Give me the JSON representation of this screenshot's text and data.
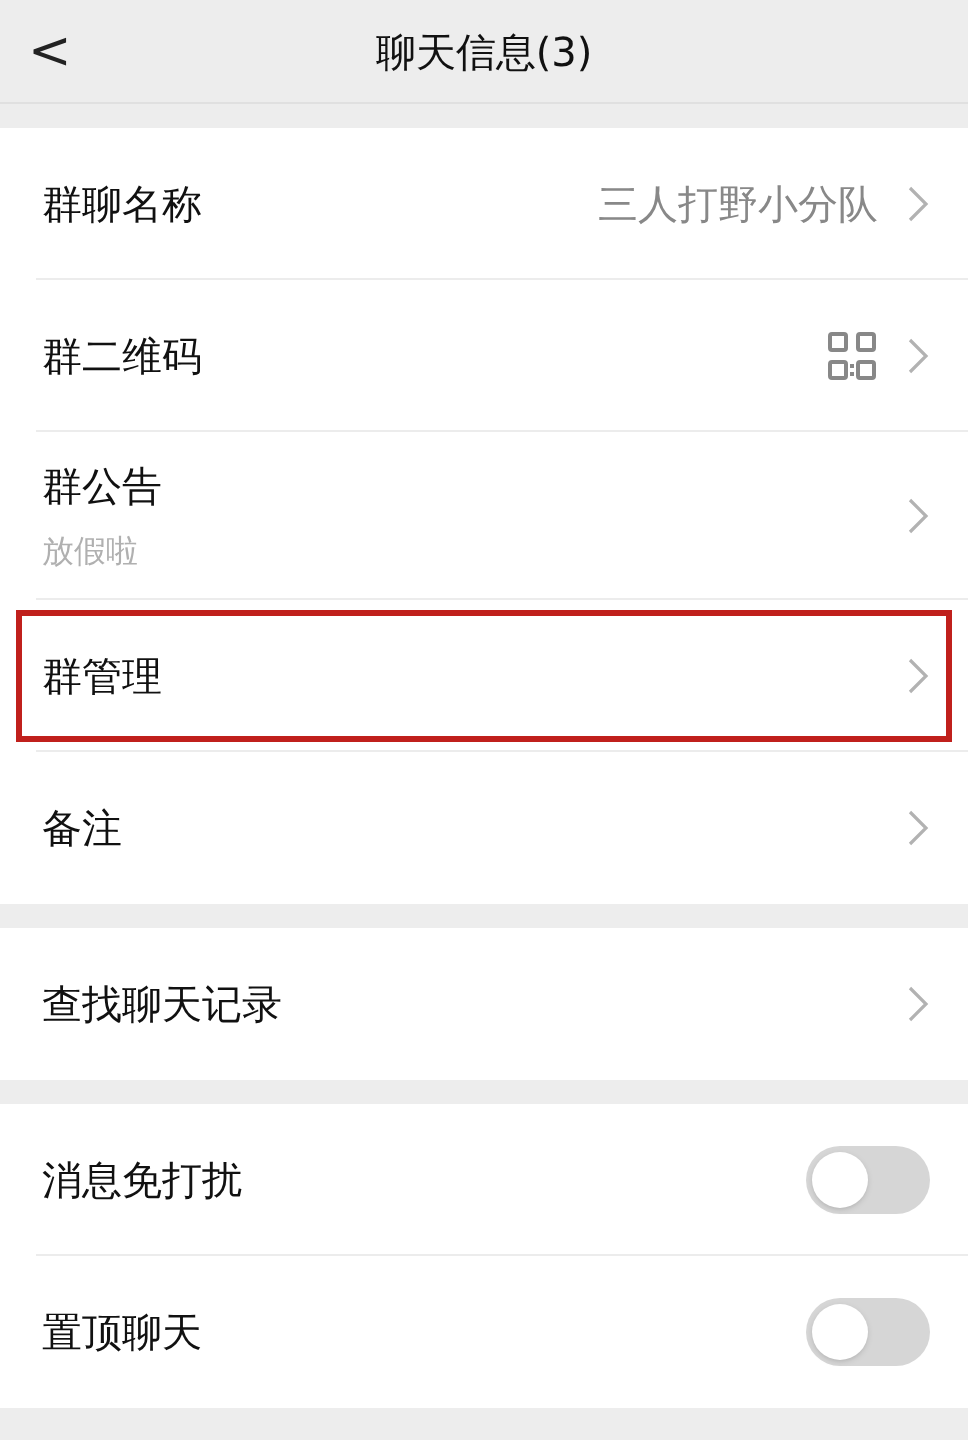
{
  "header": {
    "back": "<",
    "title": "聊天信息(3)"
  },
  "sections": [
    {
      "items": [
        {
          "kind": "value",
          "label": "群聊名称",
          "value": "三人打野小分队",
          "highlighted": false
        },
        {
          "kind": "qr",
          "label": "群二维码",
          "highlighted": false
        },
        {
          "kind": "notice",
          "label": "群公告",
          "sub": "放假啦",
          "highlighted": false
        },
        {
          "kind": "link",
          "label": "群管理",
          "highlighted": true
        },
        {
          "kind": "link",
          "label": "备注",
          "highlighted": false
        }
      ]
    },
    {
      "items": [
        {
          "kind": "link",
          "label": "查找聊天记录",
          "highlighted": false
        }
      ]
    },
    {
      "items": [
        {
          "kind": "toggle",
          "label": "消息免打扰",
          "on": false,
          "highlighted": false
        },
        {
          "kind": "toggle",
          "label": "置顶聊天",
          "on": false,
          "highlighted": false
        }
      ]
    }
  ]
}
